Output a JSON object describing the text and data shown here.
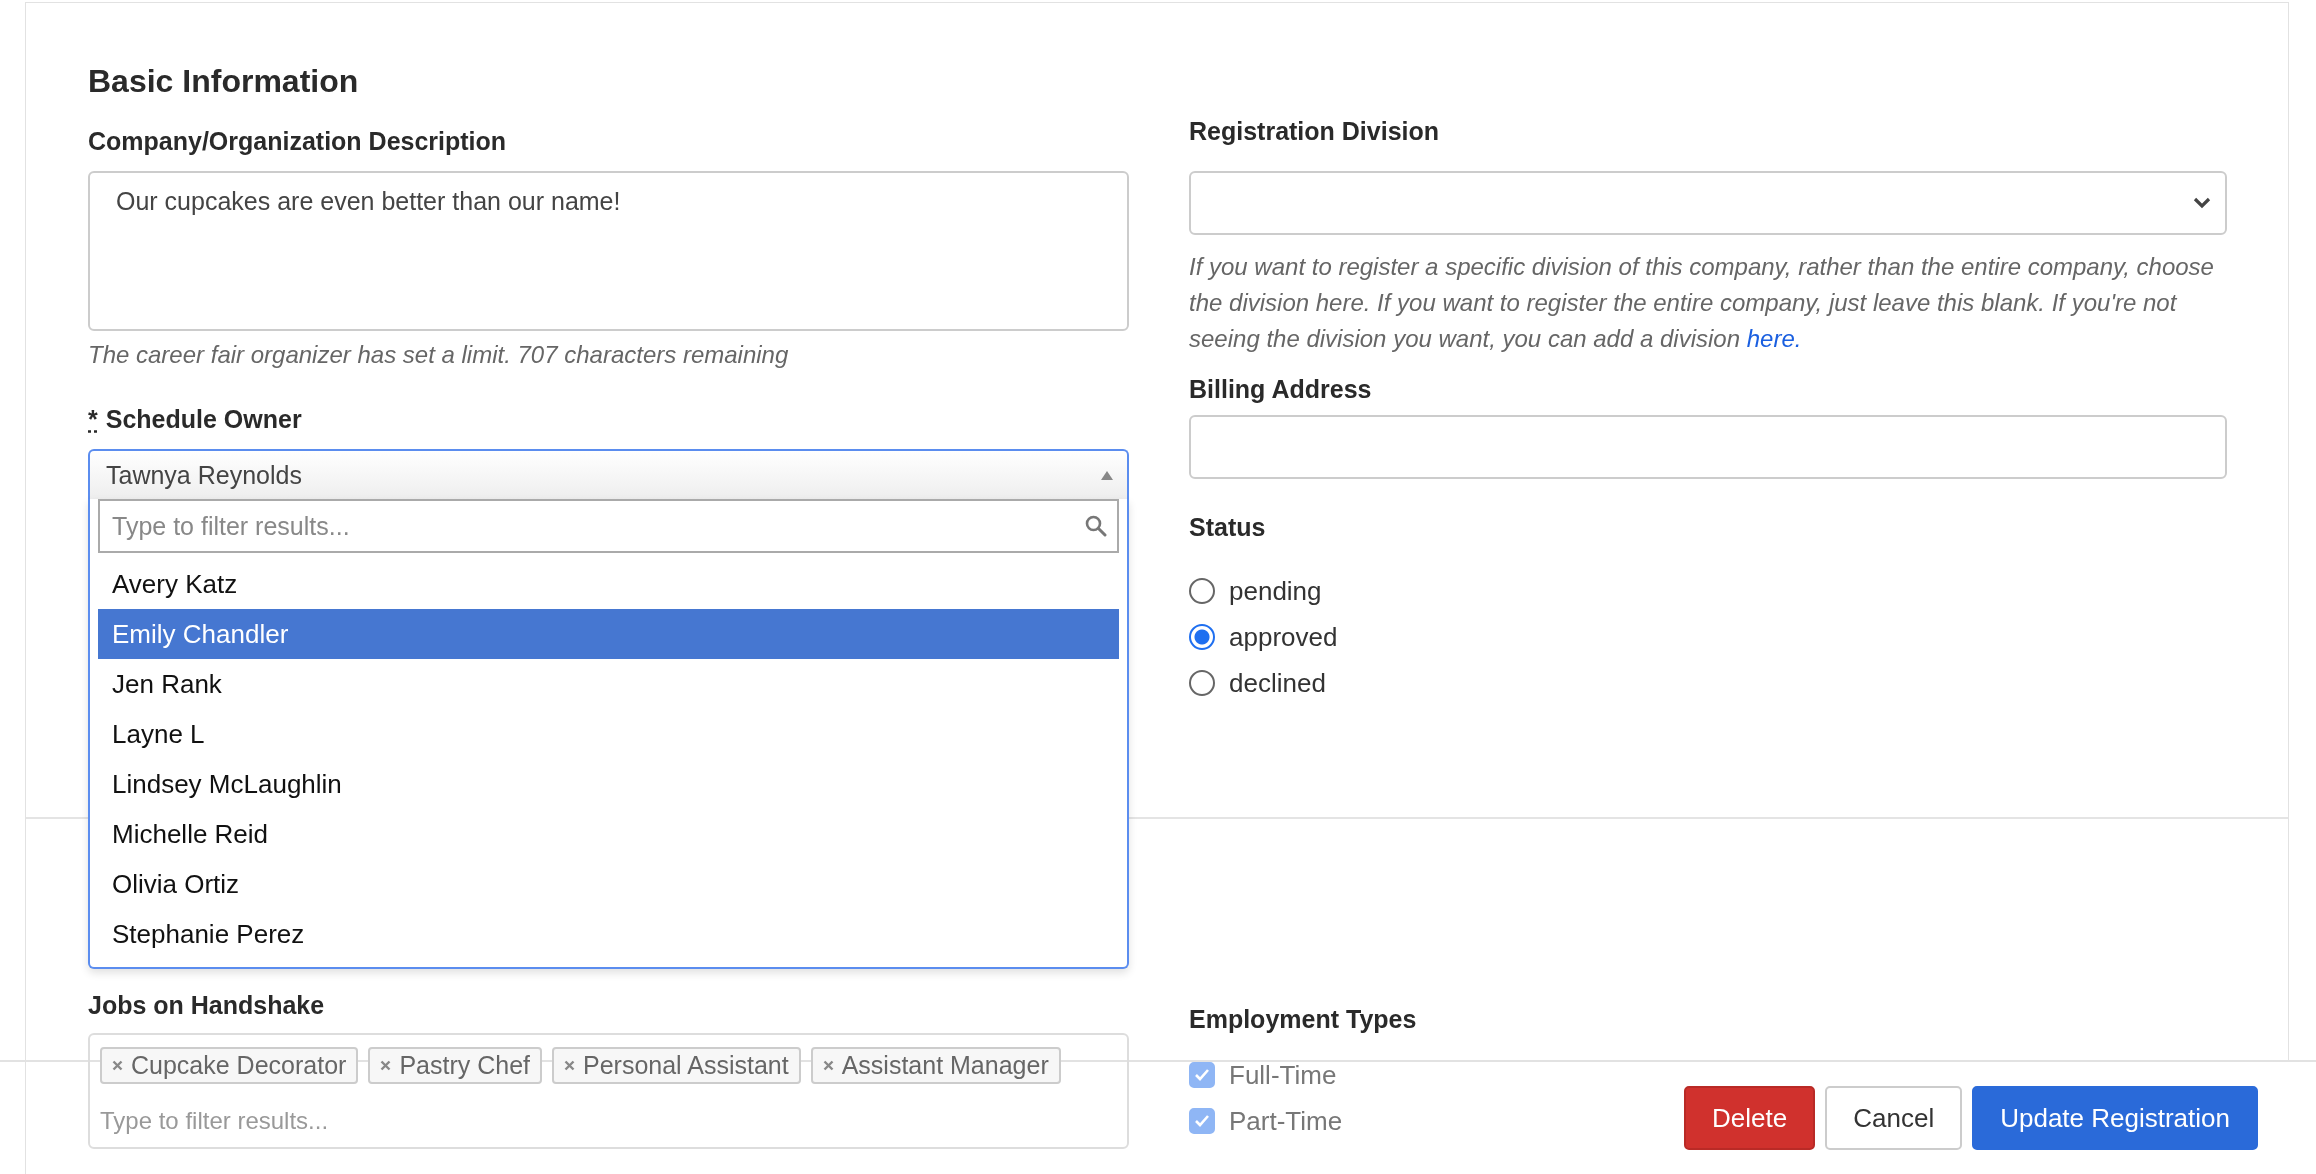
{
  "section_title": "Basic Information",
  "description": {
    "label": "Company/Organization Description",
    "value": "Our cupcakes are even better than our name!",
    "hint": "The career fair organizer has set a limit. 707 characters remaining"
  },
  "schedule_owner": {
    "required_mark": "*",
    "label": "Schedule Owner",
    "value": "Tawnya Reynolds",
    "expanded": true,
    "filter_placeholder": "Type to filter results...",
    "options": [
      {
        "label": "Avery Katz",
        "selected": false
      },
      {
        "label": "Emily Chandler",
        "selected": true
      },
      {
        "label": "Jen Rank",
        "selected": false
      },
      {
        "label": "Layne L",
        "selected": false
      },
      {
        "label": "Lindsey McLaughlin",
        "selected": false
      },
      {
        "label": "Michelle Reid",
        "selected": false
      },
      {
        "label": "Olivia Ortiz",
        "selected": false
      },
      {
        "label": "Stephanie Perez",
        "selected": false
      }
    ]
  },
  "registration_division": {
    "label": "Registration Division",
    "hint": "If you want to register a specific division of this company, rather than the entire company, choose the division here. If you want to register the entire company, just leave this blank. If you're not seeing the division you want, you can add a division",
    "link": "here."
  },
  "billing_address": {
    "label": "Billing Address"
  },
  "status": {
    "label": "Status",
    "options": [
      {
        "label": "pending",
        "selected": false
      },
      {
        "label": "approved",
        "selected": true
      },
      {
        "label": "declined",
        "selected": false
      }
    ]
  },
  "jobs": {
    "label": "Jobs on Handshake",
    "tags": [
      "Cupcake Decorator",
      "Pastry Chef",
      "Personal Assistant",
      "Assistant Manager"
    ],
    "placeholder": "Type to filter results..."
  },
  "employment_types": {
    "label": "Employment Types",
    "options": [
      {
        "label": "Full-Time",
        "checked": true
      },
      {
        "label": "Part-Time",
        "checked": true
      }
    ]
  },
  "buttons": [
    {
      "label": "Delete",
      "kind": "danger"
    },
    {
      "label": "Cancel",
      "kind": "default"
    },
    {
      "label": "Update Registration",
      "kind": "primary"
    }
  ]
}
